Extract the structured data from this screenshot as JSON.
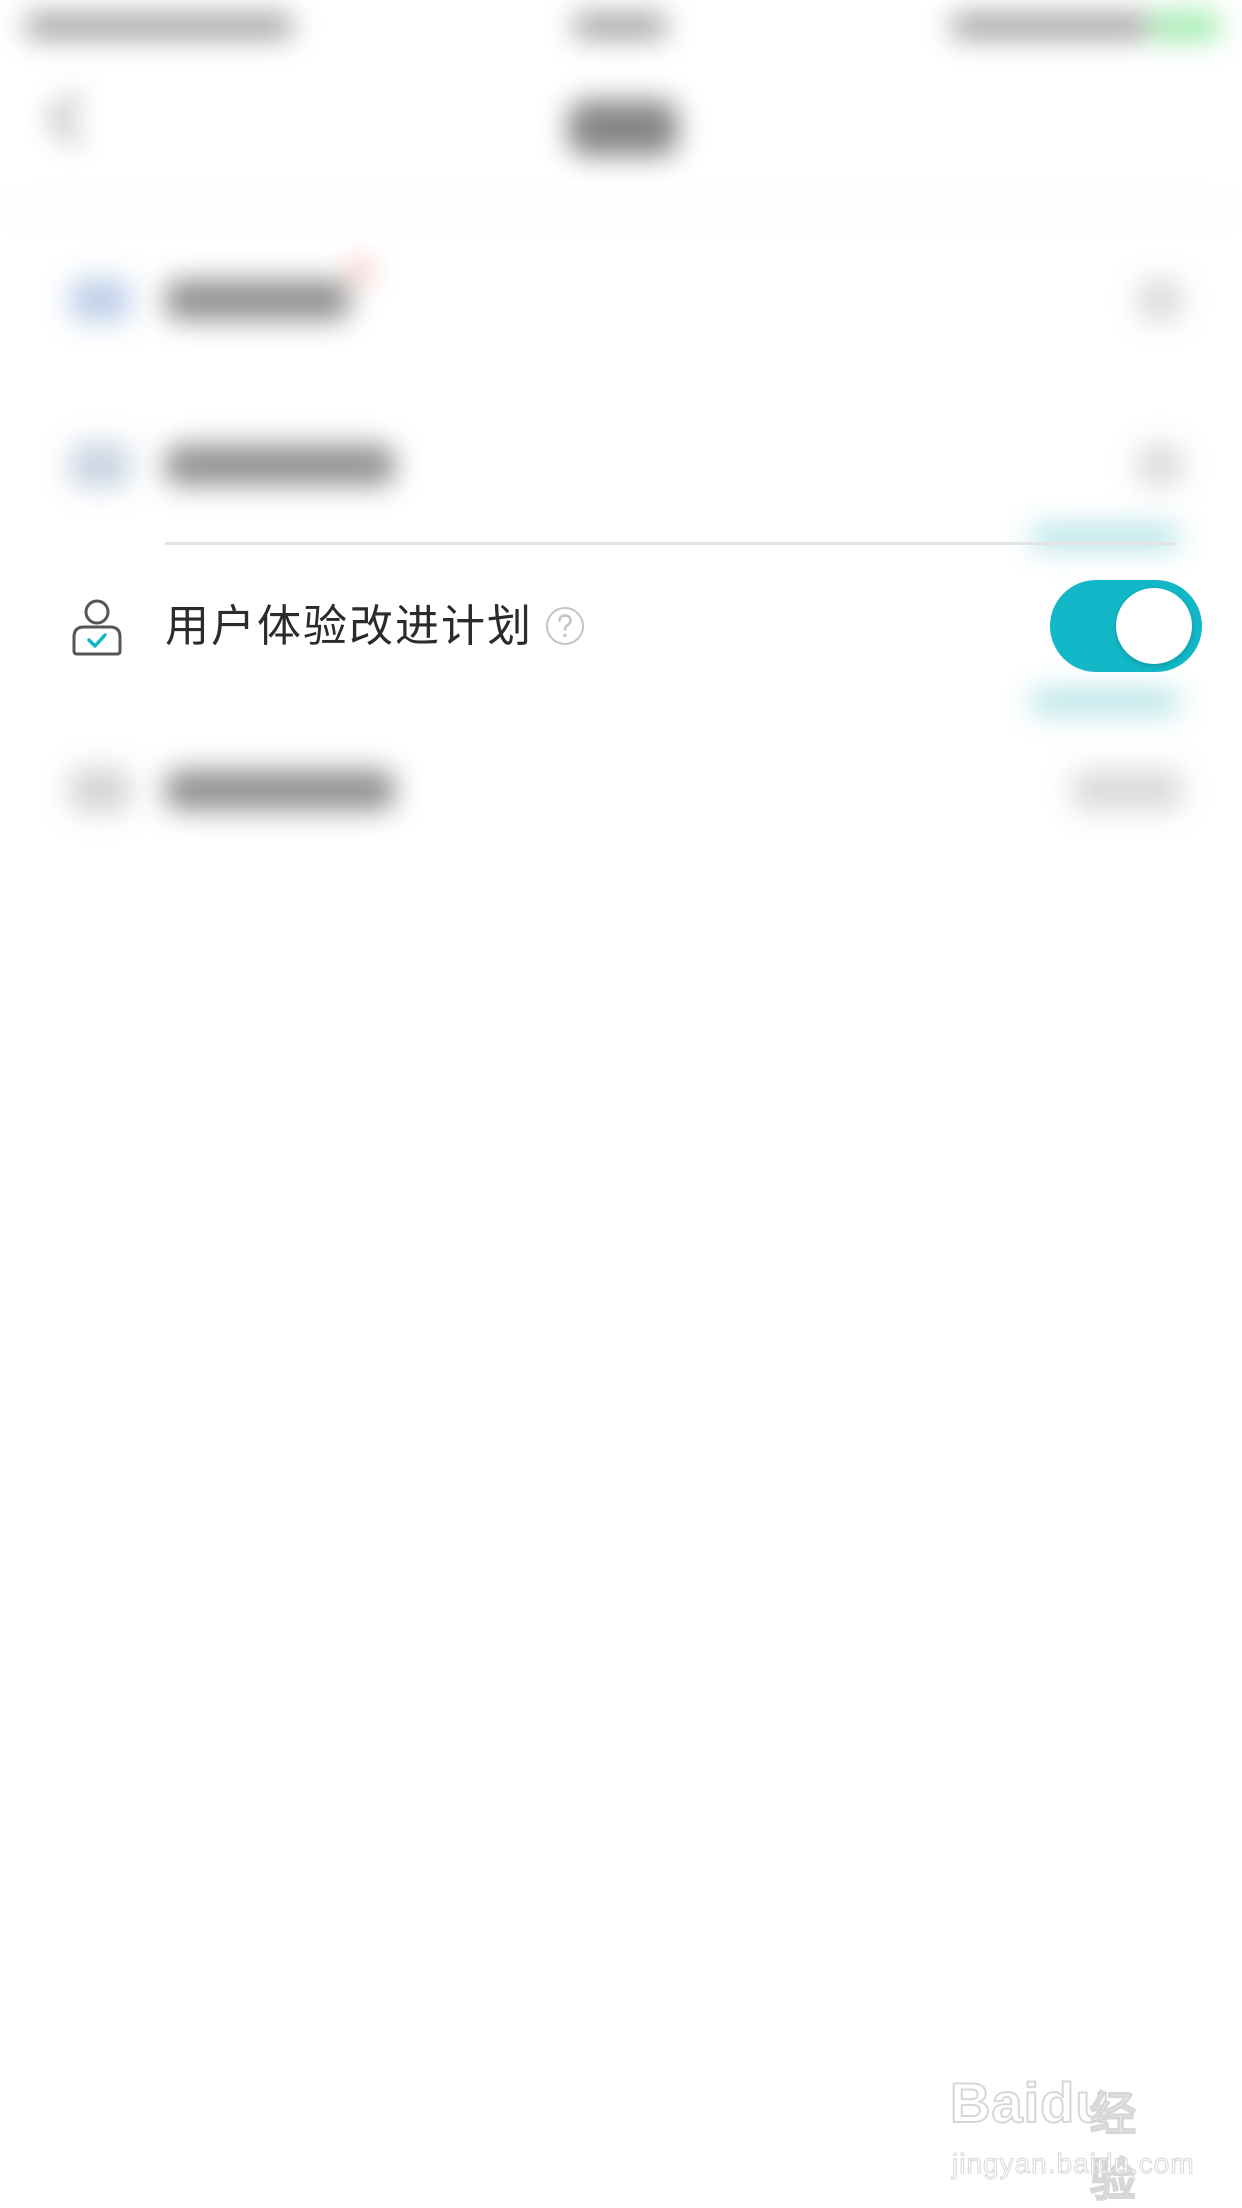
{
  "settings_row": {
    "label": "用户体验改进计划",
    "help_icon": "question-circle-icon",
    "icon": "user-check-icon",
    "toggle_on": true,
    "toggle_color": "#12b8c7"
  },
  "watermark": {
    "brand_latin": "Bai",
    "brand_du": "du",
    "brand_cn": "经验",
    "url": "jingyan.baidu.com"
  },
  "colors": {
    "accent": "#12b8c7",
    "text": "#2b2b2b",
    "background": "#ffffff"
  }
}
